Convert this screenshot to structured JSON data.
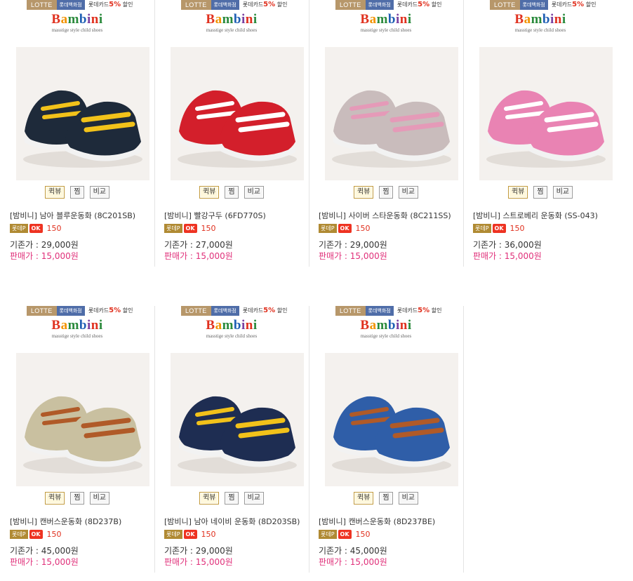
{
  "banner": {
    "lotte": "LOTTE",
    "store": "롯데백화점",
    "card_prefix": "롯데카드",
    "card_pct": "5%",
    "card_suffix": "할인"
  },
  "logo": {
    "word": "Bambini",
    "tagline": "masstige style child shoes"
  },
  "buttons": {
    "quick": "퀵뷰",
    "wish": "찜",
    "compare": "비교"
  },
  "labels": {
    "badge_mp": "롯데P",
    "badge_ok": "OK",
    "orig_prefix": "기존가 : ",
    "sale_prefix": "판매가 : "
  },
  "products": [
    {
      "name": "[밤비니] 남아 블루운동화 (8C201SB)",
      "points": "150",
      "orig": "29,000원",
      "sale": "15,000원",
      "shoe_color": "#1e2a3a",
      "accent": "#f2c21a"
    },
    {
      "name": "[밤비니] 빨강구두 (6FD770S)",
      "points": "150",
      "orig": "27,000원",
      "sale": "15,000원",
      "shoe_color": "#d31f2b",
      "accent": "#ffffff"
    },
    {
      "name": "[밤비니] 사이버 스타운동화 (8C211SS)",
      "points": "150",
      "orig": "29,000원",
      "sale": "15,000원",
      "shoe_color": "#c9bcbc",
      "accent": "#e59ab8"
    },
    {
      "name": "[밤비니] 스트로베리 운동화 (SS-043)",
      "points": "150",
      "orig": "36,000원",
      "sale": "15,000원",
      "shoe_color": "#e983b3",
      "accent": "#ffffff"
    },
    {
      "name": "[밤비니] 캔버스운동화 (8D237B)",
      "points": "150",
      "orig": "45,000원",
      "sale": "15,000원",
      "shoe_color": "#c9c0a0",
      "accent": "#b05a28"
    },
    {
      "name": "[밤비니] 남아 네이비 운동화 (8D203SB)",
      "points": "150",
      "orig": "29,000원",
      "sale": "15,000원",
      "shoe_color": "#1e2d52",
      "accent": "#f2c21a"
    },
    {
      "name": "[밤비니] 캔버스운동화 (8D237BE)",
      "points": "150",
      "orig": "45,000원",
      "sale": "15,000원",
      "shoe_color": "#2f5ea8",
      "accent": "#b05a28"
    }
  ]
}
